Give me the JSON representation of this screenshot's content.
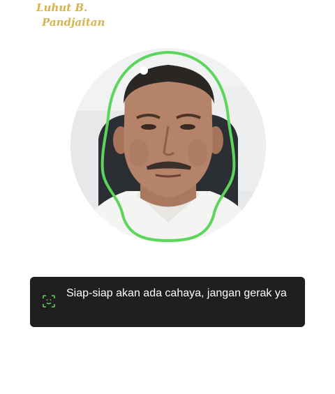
{
  "watermark": {
    "line1": "Luhut B.",
    "line2": "Pandjaitan",
    "color": "#d8b24a"
  },
  "camera": {
    "outline_color": "#5bd65b"
  },
  "toast": {
    "icon": "face-scan-icon",
    "message": "Siap-siap akan ada cahaya, jangan gerak ya",
    "background": "#1f1f1f",
    "icon_color": "#5bd65b"
  }
}
